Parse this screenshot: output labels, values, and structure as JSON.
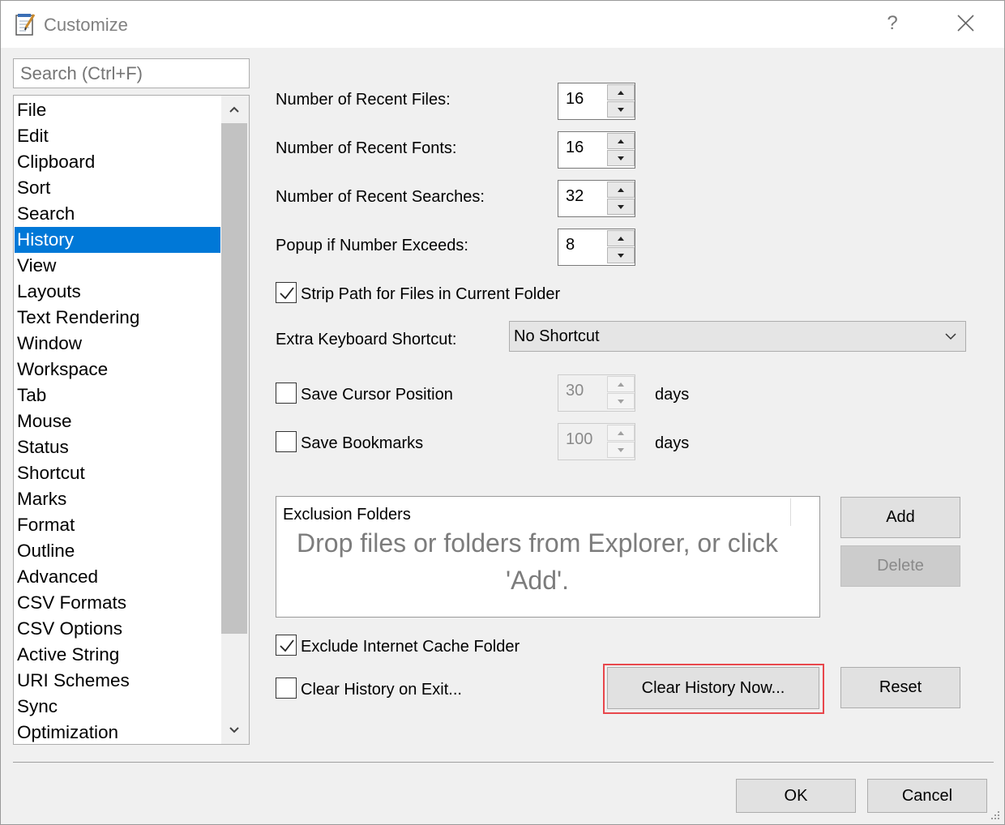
{
  "window": {
    "title": "Customize",
    "help_label": "?"
  },
  "search": {
    "placeholder": "Search (Ctrl+F)"
  },
  "categories": [
    "File",
    "Edit",
    "Clipboard",
    "Sort",
    "Search",
    "History",
    "View",
    "Layouts",
    "Text Rendering",
    "Window",
    "Workspace",
    "Tab",
    "Mouse",
    "Status",
    "Shortcut",
    "Marks",
    "Format",
    "Outline",
    "Advanced",
    "CSV Formats",
    "CSV Options",
    "Active String",
    "URI Schemes",
    "Sync",
    "Optimization"
  ],
  "selected_category": "History",
  "settings": {
    "recent_files_label": "Number of Recent Files:",
    "recent_files_value": "16",
    "recent_fonts_label": "Number of Recent Fonts:",
    "recent_fonts_value": "16",
    "recent_searches_label": "Number of Recent Searches:",
    "recent_searches_value": "32",
    "popup_label": "Popup if Number Exceeds:",
    "popup_value": "8",
    "strip_path_label": "Strip Path for Files in Current Folder",
    "strip_path_checked": true,
    "shortcut_label": "Extra Keyboard Shortcut:",
    "shortcut_value": "No Shortcut",
    "save_cursor_label": "Save Cursor Position",
    "save_cursor_checked": false,
    "save_cursor_days": "30",
    "save_bookmarks_label": "Save Bookmarks",
    "save_bookmarks_checked": false,
    "save_bookmarks_days": "100",
    "days_label": "days",
    "exclusion_title": "Exclusion Folders",
    "exclusion_hint": "Drop files or folders from Explorer, or click 'Add'.",
    "add_label": "Add",
    "delete_label": "Delete",
    "exclude_cache_label": "Exclude Internet Cache Folder",
    "exclude_cache_checked": true,
    "clear_on_exit_label": "Clear History on Exit...",
    "clear_on_exit_checked": false,
    "clear_now_label": "Clear History Now...",
    "reset_label": "Reset"
  },
  "footer": {
    "ok_label": "OK",
    "cancel_label": "Cancel"
  },
  "colors": {
    "selection": "#0078d7",
    "highlight": "#e8474c"
  }
}
